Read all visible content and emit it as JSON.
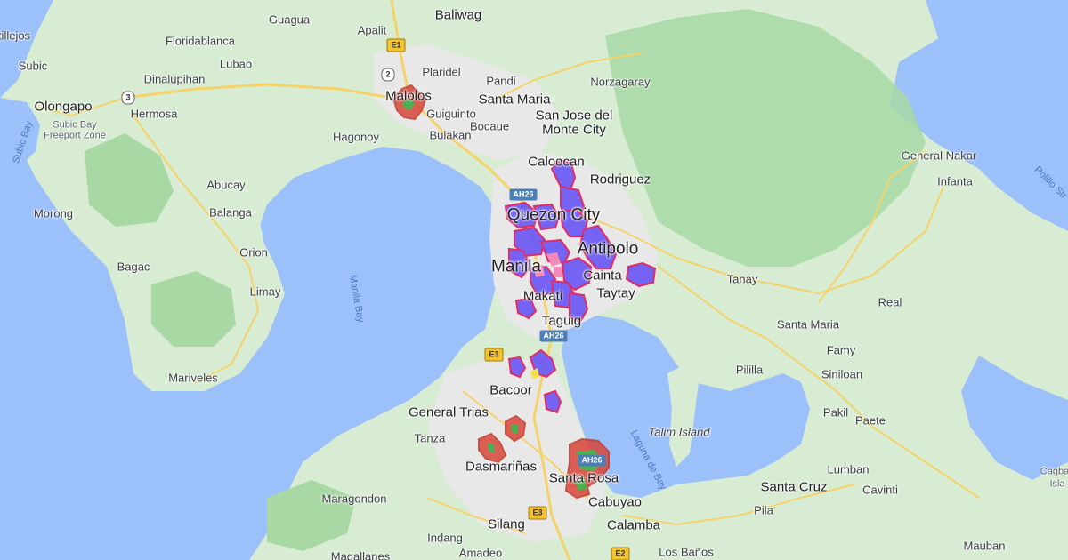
{
  "colors": {
    "water": "#9cc0f9",
    "land": "#d8ecd3",
    "forest": "#a8d9a4",
    "urban": "#e8e8e8",
    "road": "#f5d36b",
    "zone_fill": "#6f5cf5",
    "zone_stroke": "#e0245e",
    "hotspot_fill": "#d9463b",
    "hotspot_core": "#4caf50"
  },
  "labels": {
    "baliwag": "Baliwag",
    "guagua": "Guagua",
    "apalit": "Apalit",
    "tillejos": "tillejos",
    "floridablanca": "Floridablanca",
    "subic": "Subic",
    "lubao": "Lubao",
    "plaridel": "Plaridel",
    "pandi": "Pandi",
    "dinalupihan": "Dinalupihan",
    "norzagaray": "Norzagaray",
    "malolos": "Malolos",
    "santa_maria_n": "Santa Maria",
    "olongapo": "Olongapo",
    "hermosa": "Hermosa",
    "guiguinto": "Guiguinto",
    "subic_bay_fz_1": "Subic Bay",
    "subic_bay_fz_2": "Freeport Zone",
    "bocaue": "Bocaue",
    "sjdm_1": "San Jose del",
    "sjdm_2": "Monte City",
    "hagonoy": "Hagonoy",
    "bulakan": "Bulakan",
    "caloocan": "Caloocan",
    "general_nakar": "General Nakar",
    "abucay": "Abucay",
    "rodriguez": "Rodriguez",
    "infanta": "Infanta",
    "morong": "Morong",
    "balanga": "Balanga",
    "quezon_city": "Quezon City",
    "antipolo": "Antipolo",
    "orion": "Orion",
    "bagac": "Bagac",
    "manila": "Manila",
    "cainta": "Cainta",
    "tanay": "Tanay",
    "limay": "Limay",
    "taytay": "Taytay",
    "makati": "Makati",
    "real": "Real",
    "santa_maria_e": "Santa Maria",
    "taguig": "Taguig",
    "mariveles": "Mariveles",
    "famy": "Famy",
    "pililla": "Pililla",
    "siniloan": "Siniloan",
    "bacoor": "Bacoor",
    "general_trias": "General Trias",
    "pakil": "Pakil",
    "paete": "Paete",
    "talim_island": "Talim Island",
    "tanza": "Tanza",
    "dasmarinas": "Dasmariñas",
    "lumban": "Lumban",
    "santa_rosa": "Santa Rosa",
    "santa_cruz": "Santa Cruz",
    "cavinti": "Cavinti",
    "maragondon": "Maragondon",
    "cabuyao": "Cabuyao",
    "pila": "Pila",
    "silang": "Silang",
    "calamba": "Calamba",
    "indang": "Indang",
    "amadeo": "Amadeo",
    "los_banos": "Los Baños",
    "mauban": "Mauban",
    "magallanes": "Magallanes",
    "cagbalete_1": "Cagba",
    "cagbalete_2": "Isla"
  },
  "water_labels": {
    "subic_bay": "Subic Bay",
    "manila_bay": "Manila Bay",
    "laguna_de_bay": "Laguna de Bay",
    "polillo": "Polillo Str"
  },
  "shields": {
    "e1": "E1",
    "n2": "2",
    "n3": "3",
    "ah26_a": "AH26",
    "ah26_b": "AH26",
    "ah26_c": "AH26",
    "e3_a": "E3",
    "e3_b": "E3",
    "e2": "E2"
  }
}
